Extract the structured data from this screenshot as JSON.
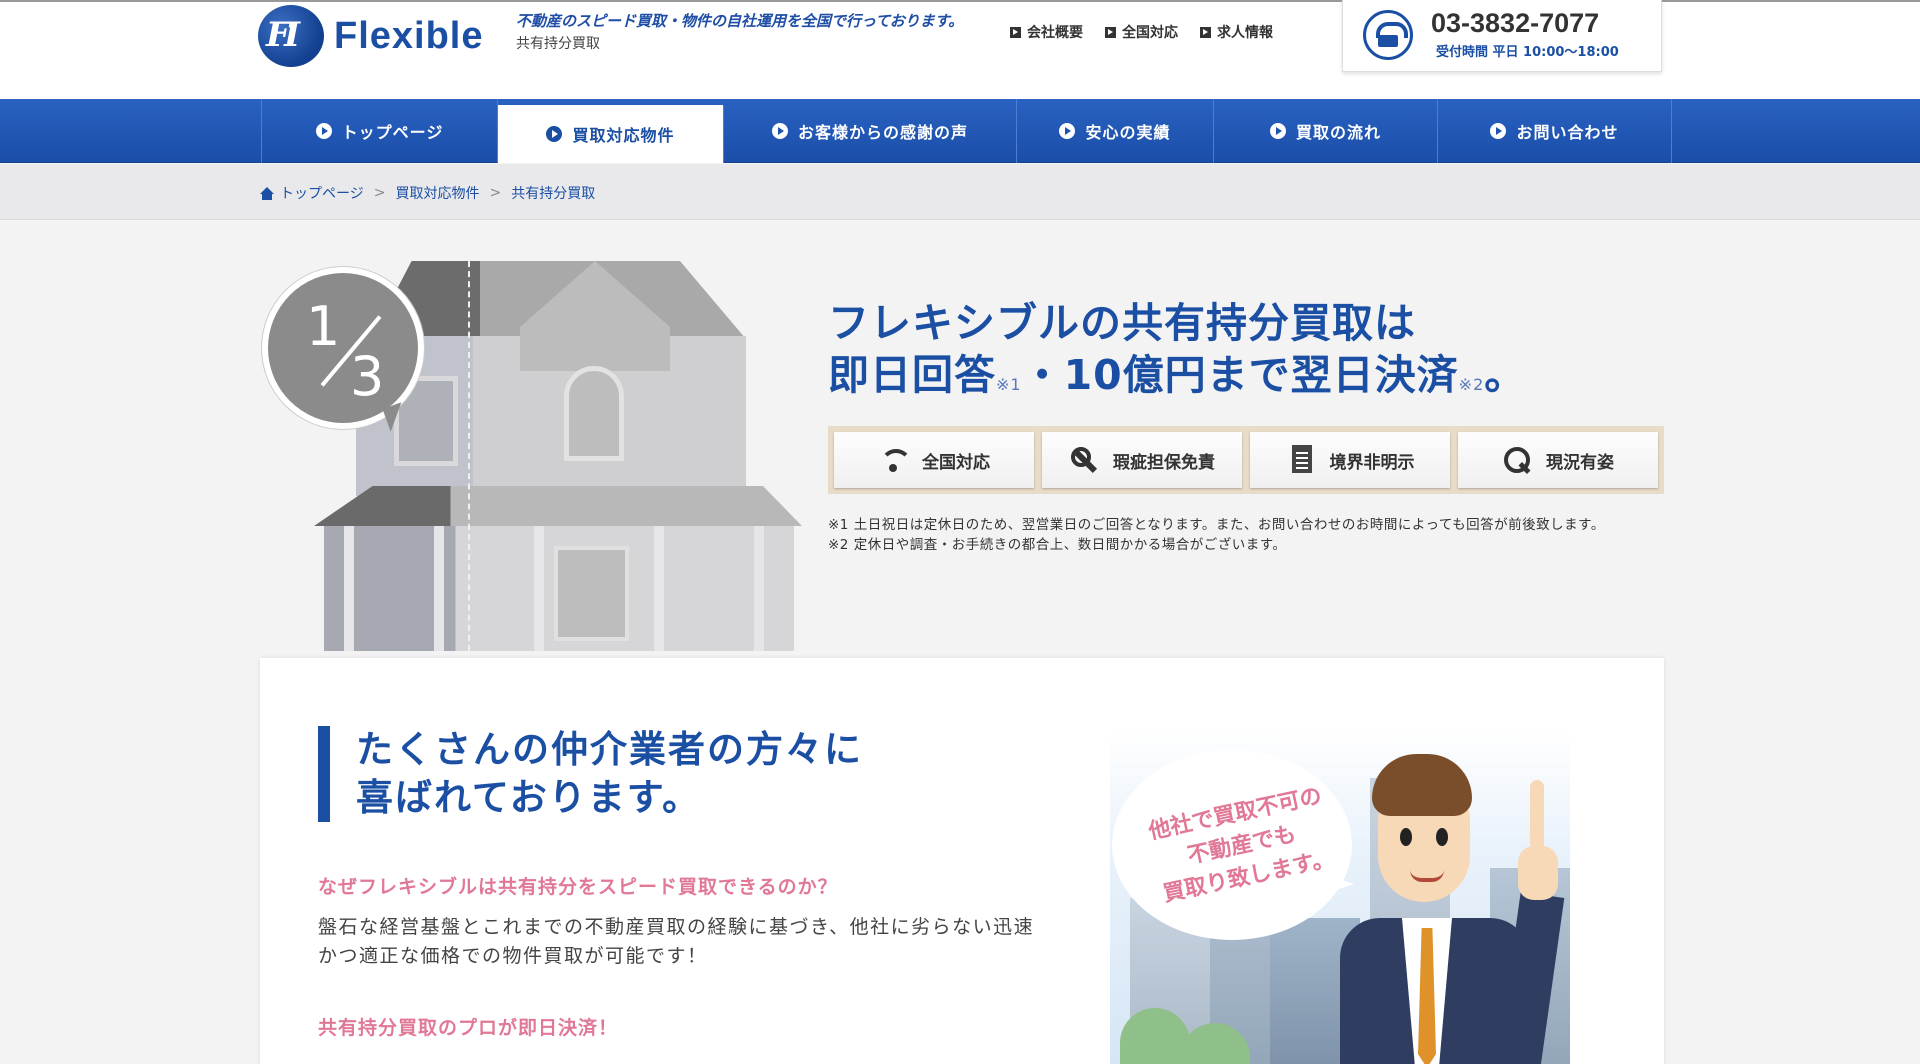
{
  "header": {
    "logo_text": "Flexible",
    "logo_mark_glyph": "FI",
    "tagline": "不動産のスピード買取・物件の自社運用を全国で行っております。",
    "subtitle": "共有持分買取",
    "links": [
      {
        "label": "会社概要"
      },
      {
        "label": "全国対応"
      },
      {
        "label": "求人情報"
      }
    ],
    "phone": {
      "number": "03-3832-7077",
      "hours": "受付時間 平日 10:00～18:00",
      "icon": "telephone-icon"
    }
  },
  "nav": {
    "items": [
      {
        "label": "トップページ"
      },
      {
        "label": "買取対応物件",
        "active": true
      },
      {
        "label": "お客様からの感謝の声"
      },
      {
        "label": "安心の実績"
      },
      {
        "label": "買取の流れ"
      },
      {
        "label": "お問い合わせ"
      }
    ]
  },
  "breadcrumb": {
    "items": [
      "トップページ",
      "買取対応物件",
      "共有持分買取"
    ],
    "separator": ">"
  },
  "hero": {
    "fraction": {
      "numerator": "1",
      "denominator": "3"
    },
    "title_line1": "フレキシブルの共有持分買取は",
    "title_line2_a": "即日回答",
    "title_sup1": "※1",
    "title_line2_b": "・10億円まで翌日決済",
    "title_sup2": "※2",
    "title_line2_c": "。",
    "features": [
      {
        "label": "全国対応",
        "icon": "wifi-icon"
      },
      {
        "label": "瑕疵担保免責",
        "icon": "wrench-icon"
      },
      {
        "label": "境界非明示",
        "icon": "document-icon"
      },
      {
        "label": "現況有姿",
        "icon": "magnifier-icon"
      }
    ],
    "notes": [
      "※1 土日祝日は定休日のため、翌営業日のご回答となります。また、お問い合わせのお時間によっても回答が前後致します。",
      "※2 定休日や調査・お手続きの都合上、数日間かかる場合がございます。"
    ]
  },
  "content": {
    "heading_line1": "たくさんの仲介業者の方々に",
    "heading_line2": "喜ばれております。",
    "question1": "なぜフレキシブルは共有持分をスピード買取できるのか？",
    "answer1": "盤石な経営基盤とこれまでの不動産買取の経験に基づき、他社に劣らない迅速かつ適正な価格での物件買取が可能です！",
    "question2": "共有持分買取のプロが即日決済！",
    "speech_line1": "他社で買取不可の",
    "speech_line2": "不動産でも",
    "speech_line3": "買取り致します。"
  },
  "colors": {
    "brand_blue": "#1b4fa3",
    "accent_pink": "#e07896",
    "feature_bar_beige": "#e8dcc8"
  }
}
